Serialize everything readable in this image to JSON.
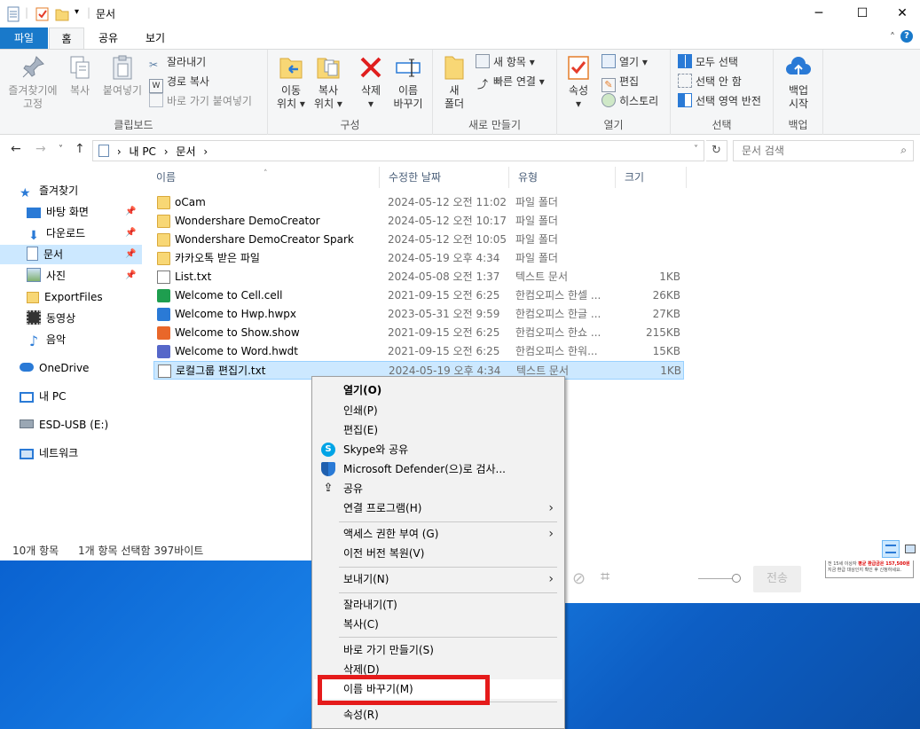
{
  "window": {
    "title": "문서",
    "minimize": "─",
    "maximize": "☐",
    "close": "✕"
  },
  "tabs": [
    {
      "label": "파일"
    },
    {
      "label": "홈"
    },
    {
      "label": "공유"
    },
    {
      "label": "보기"
    }
  ],
  "ribbon": {
    "clipboard": {
      "pin_label_1": "즐겨찾기에",
      "pin_label_2": "고정",
      "copy": "복사",
      "paste": "붙여넣기",
      "cut": "잘라내기",
      "copy_path": "경로 복사",
      "paste_shortcut": "바로 가기 붙여넣기",
      "group": "클립보드"
    },
    "organize": {
      "move_1": "이동",
      "move_2": "위치 ▾",
      "copyto_1": "복사",
      "copyto_2": "위치 ▾",
      "delete_1": "삭제",
      "delete_2": "▾",
      "rename_1": "이름",
      "rename_2": "바꾸기",
      "group": "구성"
    },
    "new": {
      "folder_1": "새",
      "folder_2": "폴더",
      "new_item": "새 항목 ▾",
      "easy_access": "빠른 연결 ▾",
      "group": "새로 만들기"
    },
    "open": {
      "properties_1": "속성",
      "properties_2": "▾",
      "open": "열기 ▾",
      "edit": "편집",
      "history": "히스토리",
      "group": "열기"
    },
    "select": {
      "select_all": "모두 선택",
      "select_none": "선택 안 함",
      "invert": "선택 영역 반전",
      "group": "선택"
    },
    "backup": {
      "start_1": "백업",
      "start_2": "시작",
      "group": "백업"
    }
  },
  "address": {
    "crumb_pc": "내 PC",
    "crumb_sep": "›",
    "crumb_docs": "문서",
    "search_placeholder": "문서 검색"
  },
  "nav": {
    "quick_access": "즐겨찾기",
    "desktop": "바탕 화면",
    "downloads": "다운로드",
    "documents": "문서",
    "pictures": "사진",
    "exportfiles": "ExportFiles",
    "videos": "동영상",
    "music": "음악",
    "onedrive": "OneDrive",
    "thispc": "내 PC",
    "usb": "ESD-USB (E:)",
    "network": "네트워크"
  },
  "columns": {
    "name": "이름",
    "date": "수정한 날짜",
    "type": "유형",
    "size": "크기"
  },
  "files": [
    {
      "name": "oCam",
      "date": "2024-05-12 오전 11:02",
      "type": "파일 폴더",
      "size": "",
      "icon": "folder-icon"
    },
    {
      "name": "Wondershare DemoCreator",
      "date": "2024-05-12 오전 10:17",
      "type": "파일 폴더",
      "size": "",
      "icon": "folder-icon"
    },
    {
      "name": "Wondershare DemoCreator Spark",
      "date": "2024-05-12 오전 10:05",
      "type": "파일 폴더",
      "size": "",
      "icon": "folder-icon"
    },
    {
      "name": "카카오톡 받은 파일",
      "date": "2024-05-19 오후 4:34",
      "type": "파일 폴더",
      "size": "",
      "icon": "folder-icon"
    },
    {
      "name": "List.txt",
      "date": "2024-05-08 오전 1:37",
      "type": "텍스트 문서",
      "size": "1KB",
      "icon": "text-file-icon"
    },
    {
      "name": "Welcome to Cell.cell",
      "date": "2021-09-15 오전 6:25",
      "type": "한컴오피스 한셀 ...",
      "size": "26KB",
      "icon": "hancell-icon"
    },
    {
      "name": "Welcome to Hwp.hwpx",
      "date": "2023-05-31 오전 9:59",
      "type": "한컴오피스 한글 ...",
      "size": "27KB",
      "icon": "hwp-icon"
    },
    {
      "name": "Welcome to Show.show",
      "date": "2021-09-15 오전 6:25",
      "type": "한컴오피스 한쇼 ...",
      "size": "215KB",
      "icon": "hanshow-icon"
    },
    {
      "name": "Welcome to Word.hwdt",
      "date": "2021-09-15 오전 6:25",
      "type": "한컴오피스 한워...",
      "size": "15KB",
      "icon": "hanword-icon"
    },
    {
      "name": "로컬그룹 편집기.txt",
      "date": "2024-05-19 오후 4:34",
      "type": "텍스트 문서",
      "size": "1KB",
      "icon": "text-file-icon"
    }
  ],
  "status": {
    "count": "10개 항목",
    "selected": "1개 항목 선택함 397바이트"
  },
  "context_menu": {
    "open": "열기(O)",
    "print": "인쇄(P)",
    "edit": "편집(E)",
    "skype": "Skype와 공유",
    "defender": "Microsoft Defender(으)로 검사...",
    "share": "공유",
    "open_with": "연결 프로그램(H)",
    "give_access": "액세스 권한 부여 (G)",
    "restore": "이전 버전 복원(V)",
    "send_to": "보내기(N)",
    "cut": "잘라내기(T)",
    "copy": "복사(C)",
    "create_shortcut": "바로 가기 만들기(S)",
    "delete": "삭제(D)",
    "rename": "이름 바꾸기(M)",
    "properties": "속성(R)"
  },
  "background_app": {
    "send": "전송",
    "promo_line1": "전 15세 이상자",
    "promo_highlight": "평균 환급금은 157,500원",
    "promo_line2": "지금 환급 대상인지 확인 후 신청하세요."
  },
  "colors": {
    "accent": "#1979ca",
    "selection": "#cce8ff",
    "highlight_box": "#e51b1b"
  }
}
